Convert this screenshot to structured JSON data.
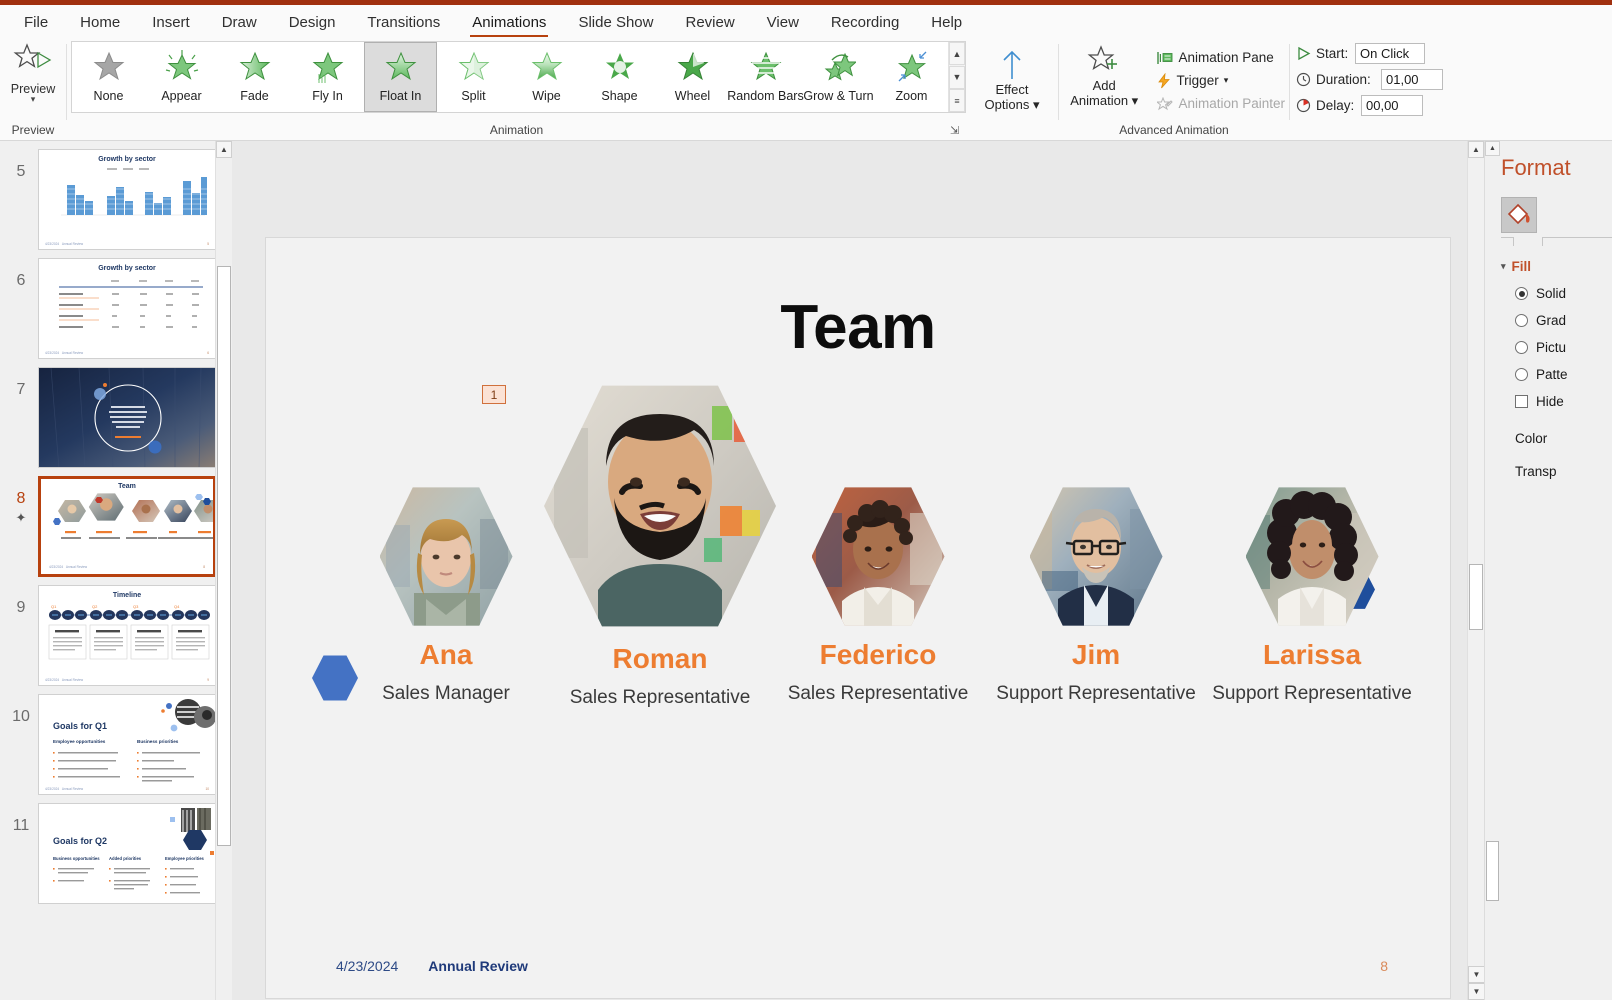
{
  "app": {
    "accent_color": "#b7410e"
  },
  "ribbon": {
    "tabs": [
      {
        "label": "File"
      },
      {
        "label": "Home"
      },
      {
        "label": "Insert"
      },
      {
        "label": "Draw"
      },
      {
        "label": "Design"
      },
      {
        "label": "Transitions"
      },
      {
        "label": "Animations"
      },
      {
        "label": "Slide Show"
      },
      {
        "label": "Review"
      },
      {
        "label": "View"
      },
      {
        "label": "Recording"
      },
      {
        "label": "Help"
      }
    ],
    "active_tab": "Animations",
    "preview_group": {
      "button_label": "Preview",
      "group_label": "Preview"
    },
    "animation_group": {
      "group_label": "Animation",
      "items": [
        {
          "label": "None",
          "icon": "star-gray"
        },
        {
          "label": "Appear",
          "icon": "star-sparkle"
        },
        {
          "label": "Fade",
          "icon": "star-fade"
        },
        {
          "label": "Fly In",
          "icon": "star-flyin"
        },
        {
          "label": "Float In",
          "icon": "star-floatin"
        },
        {
          "label": "Split",
          "icon": "star-split"
        },
        {
          "label": "Wipe",
          "icon": "star-wipe"
        },
        {
          "label": "Shape",
          "icon": "star-shape"
        },
        {
          "label": "Wheel",
          "icon": "star-wheel"
        },
        {
          "label": "Random Bars",
          "icon": "star-randombars"
        },
        {
          "label": "Grow & Turn",
          "icon": "star-growturn"
        },
        {
          "label": "Zoom",
          "icon": "star-zoom"
        }
      ],
      "selected": "Float In"
    },
    "effect_options": {
      "line1": "Effect",
      "line2": "Options"
    },
    "advanced_group": {
      "group_label": "Advanced Animation",
      "add_animation": {
        "line1": "Add",
        "line2": "Animation"
      },
      "animation_pane": "Animation Pane",
      "trigger": "Trigger",
      "animation_painter": "Animation Painter"
    },
    "timing_group": {
      "start_label": "Start:",
      "start_value": "On Click",
      "duration_label": "Duration:",
      "duration_value": "01,00",
      "delay_label": "Delay:",
      "delay_value": "00,00"
    }
  },
  "thumbnails": [
    {
      "number": "5",
      "title": "Growth by sector",
      "kind": "chart",
      "current": false,
      "starred": false
    },
    {
      "number": "6",
      "title": "Growth by sector",
      "kind": "table",
      "current": false,
      "starred": false
    },
    {
      "number": "7",
      "title": "",
      "kind": "quote",
      "current": false,
      "starred": false,
      "quote": "Lorissa was great to work with. Patrice was my representative and she anticipated my needs and worked diligently to fix my issue.",
      "attribution": "A satisfied customer"
    },
    {
      "number": "8",
      "title": "Team",
      "kind": "team",
      "current": true,
      "starred": true
    },
    {
      "number": "9",
      "title": "Timeline",
      "kind": "timeline",
      "current": false,
      "starred": false,
      "columns": [
        "Q1",
        "Q2",
        "Q3",
        "Q4"
      ],
      "card_title": "Product launch"
    },
    {
      "number": "10",
      "title": "Goals for Q1",
      "kind": "goals",
      "current": false,
      "starred": false,
      "headings": [
        "Employee opportunities",
        "Business priorities"
      ]
    },
    {
      "number": "11",
      "title": "Goals for Q2",
      "kind": "goals3",
      "current": false,
      "starred": false,
      "headings": [
        "Business opportunities",
        "Added priorities",
        "Employee priorities"
      ]
    }
  ],
  "slide": {
    "title": "Team",
    "animation_badge": "1",
    "members": [
      {
        "name": "Ana",
        "role": "Sales Manager",
        "photo": "woman-blonde-portrait"
      },
      {
        "name": "Roman",
        "role": "Sales Representative",
        "photo": "man-beard-portrait"
      },
      {
        "name": "Federico",
        "role": "Sales Representative",
        "photo": "man-curly-portrait"
      },
      {
        "name": "Jim",
        "role": "Support Representative",
        "photo": "man-glasses-portrait"
      },
      {
        "name": "Larissa",
        "role": "Support Representative",
        "photo": "woman-curly-portrait"
      }
    ],
    "footer_date": "4/23/2024",
    "footer_title": "Annual Review",
    "page_number": "8",
    "name_color": "#ed7d31",
    "deco_hex_colors": [
      "#4472c4",
      "#a9c4ef",
      "#1f4e9c"
    ]
  },
  "format_pane": {
    "title": "Format",
    "fill_section": "Fill",
    "options": [
      {
        "label": "Solid",
        "selected": true,
        "type": "radio"
      },
      {
        "label": "Grad",
        "selected": false,
        "type": "radio"
      },
      {
        "label": "Pictu",
        "selected": false,
        "type": "radio"
      },
      {
        "label": "Patte",
        "selected": false,
        "type": "radio"
      },
      {
        "label": "Hide",
        "selected": false,
        "type": "checkbox"
      }
    ],
    "color_label": "Color",
    "transparency_label": "Transp"
  }
}
